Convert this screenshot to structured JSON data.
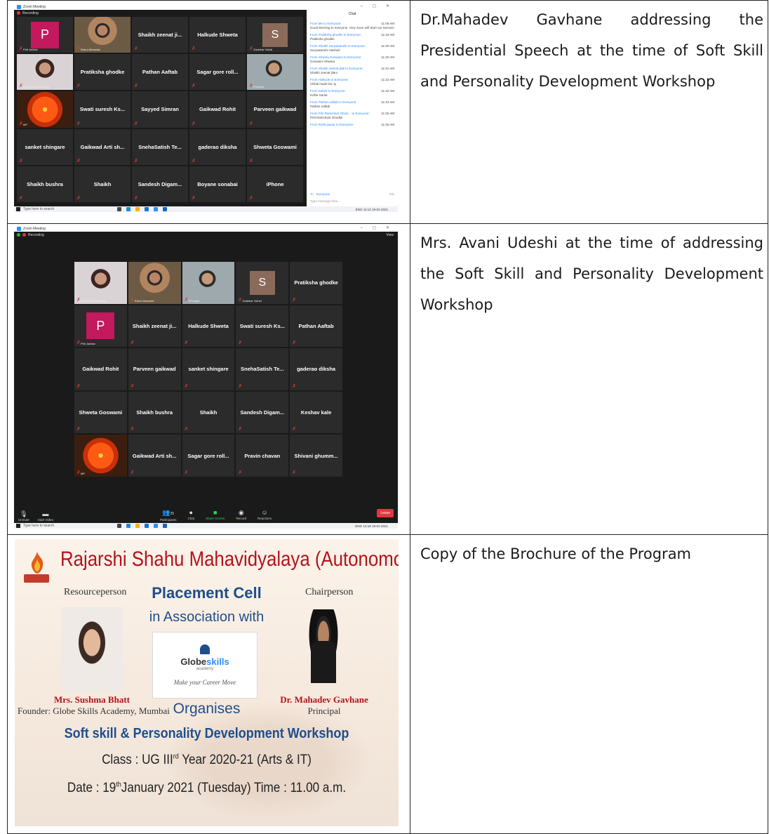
{
  "rows": [
    {
      "caption": "Dr.Mahadev Gavhane addressing the Presidential Speech at the time of Soft Skill and Personality Development Workshop",
      "screenshot": {
        "window_title": "Zoom Meeting",
        "recording_label": "Recording",
        "tiles": [
          {
            "name": "Priti Jadhav",
            "avatar": "P"
          },
          {
            "name": "Rahul Athawale",
            "photo": "man"
          },
          {
            "name": "Shaikh zeenat ji...",
            "label": true
          },
          {
            "name": "Halkude Shweta",
            "label": true
          },
          {
            "name": "Gadekar Vishal",
            "avatar": "S"
          },
          {
            "name": "Globeskills Academy",
            "photo": "woman"
          },
          {
            "name": "Pratiksha ghodke",
            "label": true
          },
          {
            "name": "Pathan Aaftab",
            "label": true
          },
          {
            "name": "Sagar gore roll...",
            "label": true
          },
          {
            "name": "Principal",
            "photo": "man2"
          },
          {
            "name": "MP",
            "photo": "flower",
            "active": true
          },
          {
            "name": "Swati suresh Ks...",
            "label": true
          },
          {
            "name": "Sayyed Simran",
            "label": true
          },
          {
            "name": "Gaikwad Rohit",
            "label": true
          },
          {
            "name": "Parveen gaikwad",
            "label": true
          },
          {
            "name": "sanket shingare",
            "label": true
          },
          {
            "name": "Gaikwad Arti sh...",
            "label": true
          },
          {
            "name": "SnehaSatish Te...",
            "label": true
          },
          {
            "name": "gaderao diksha",
            "label": true
          },
          {
            "name": "Shweta Goswami",
            "label": true
          },
          {
            "name": "Shaikh bushra",
            "label": true
          },
          {
            "name": "Shaikh",
            "label": true
          },
          {
            "name": "Sandesh Digam...",
            "label": true
          },
          {
            "name": "Boyane sonabai",
            "label": true
          },
          {
            "name": "iPhone",
            "label": true
          }
        ],
        "chat": {
          "title": "Chat",
          "messages": [
            {
              "from": "From Me to Everyone:",
              "time": "11:06 AM",
              "text": "Good Morning to everyone. Very Soon will Start our Session"
            },
            {
              "from": "From Pratiksha ghodke to Everyone:",
              "time": "11:19 AM",
              "text": "Pratiksha ghodke"
            },
            {
              "from": "From Shaikh Suryawanshi to Everyone:",
              "time": "11:20 AM",
              "text": "Suryawanshi Vaishali"
            },
            {
              "from": "From Shweta Goswami to Everyone:",
              "time": "11:20 AM",
              "text": "Goswami Shweta"
            },
            {
              "from": "From Shaikh zeenat jilali to Everyone:",
              "time": "11:21 AM",
              "text": "Shaikh zeenat jilani"
            },
            {
              "from": "From Halkude to Everyone:",
              "time": "11:22 AM",
              "text": "Vishal Hude bsc ty"
            },
            {
              "from": "From Satish to Everyone:",
              "time": "11:22 AM",
              "text": "Kolhe Sarita"
            },
            {
              "from": "From Pathan Aaftab to Everyone:",
              "time": "11:23 AM",
              "text": "Pathan Aaftab"
            },
            {
              "from": "From Priti Ramchant Gholo... to Everyone:",
              "time": "11:25 AM",
              "text": "Priti Ramchant Ghodke"
            },
            {
              "from": "From Rohit pawar to Everyone:",
              "time": "11:26 AM",
              "text": ""
            }
          ],
          "to_label": "To:",
          "to_value": "Everyone",
          "file_label": "File",
          "input_placeholder": "Type message here..."
        },
        "taskbar": {
          "search_placeholder": "Type here to search",
          "time": "11:12",
          "date": "19-01-2021",
          "lang": "ENG"
        }
      }
    },
    {
      "caption": "Mrs. Avani Udeshi at the time of addressing the Soft Skill and Personality Development Workshop",
      "screenshot": {
        "window_title": "Zoom Meeting",
        "recording_label": "Recording",
        "view_label": "View",
        "tiles": [
          {
            "name": "Globeskills Academy",
            "photo": "woman"
          },
          {
            "name": "Rahul Athawale",
            "photo": "man"
          },
          {
            "name": "Principal",
            "photo": "man2"
          },
          {
            "name": "Gadekar Vishal",
            "avatar": "S"
          },
          {
            "name": "Pratiksha ghodke",
            "label": true
          },
          {
            "name": "Priti Jadhav",
            "avatar": "P"
          },
          {
            "name": "Shaikh zeenat ji...",
            "label": true
          },
          {
            "name": "Halkude Shweta",
            "label": true
          },
          {
            "name": "Swati suresh Ks...",
            "label": true
          },
          {
            "name": "Pathan Aaftab",
            "label": true
          },
          {
            "name": "Gaikwad Rohit",
            "label": true
          },
          {
            "name": "Parveen gaikwad",
            "label": true
          },
          {
            "name": "sanket shingare",
            "label": true
          },
          {
            "name": "SnehaSatish Te...",
            "label": true
          },
          {
            "name": "gaderao diksha",
            "label": true
          },
          {
            "name": "Shweta Goswami",
            "label": true
          },
          {
            "name": "Shaikh bushra",
            "label": true
          },
          {
            "name": "Shaikh",
            "label": true
          },
          {
            "name": "Sandesh Digam...",
            "label": true
          },
          {
            "name": "Keshav kale",
            "label": true
          },
          {
            "name": "MP",
            "photo": "flower",
            "active": true
          },
          {
            "name": "Gaikwad Arti sh...",
            "label": true
          },
          {
            "name": "Sagar gore roll...",
            "label": true
          },
          {
            "name": "Pravin chavan",
            "label": true
          },
          {
            "name": "Shivani ghumm...",
            "label": true
          }
        ],
        "controls": {
          "unmute": "Unmute",
          "start_video": "Start Video",
          "participants": "Participants",
          "participants_count": "25",
          "chat": "Chat",
          "share_screen": "Share Screen",
          "record": "Record",
          "reactions": "Reactions",
          "leave": "Leave"
        },
        "taskbar": {
          "search_placeholder": "Type here to search",
          "time": "13:18",
          "date": "19-01-2021",
          "lang": "ENG"
        }
      }
    },
    {
      "caption": "Copy of the Brochure of the Program",
      "brochure": {
        "title": "Rajarshi Shahu Mahavidyalaya (Autonomous), Latur",
        "resource_label": "Resourceperson",
        "chair_label": "Chairperson",
        "placement": "Placement Cell",
        "association": "in Association with",
        "partner_name_a": "Globe",
        "partner_name_b": "skills",
        "partner_sub": "academy",
        "partner_tagline": "Make your Career Move",
        "resource_name": "Mrs. Sushma Bhatt",
        "resource_role": "Founder: Globe Skills Academy, Mumbai",
        "chair_name": "Dr. Mahadev Gavhane",
        "chair_role": "Principal",
        "organises": "Organises",
        "workshop": "Soft skill & Personality Development Workshop",
        "class_prefix": "Class : UG III",
        "class_sup": "rd",
        "class_suffix": " Year 2020-21 (Arts & IT)",
        "date_prefix": "Date : 19",
        "date_sup": "th",
        "date_suffix": "January 2021 (Tuesday) Time : 11.00 a.m."
      }
    }
  ]
}
